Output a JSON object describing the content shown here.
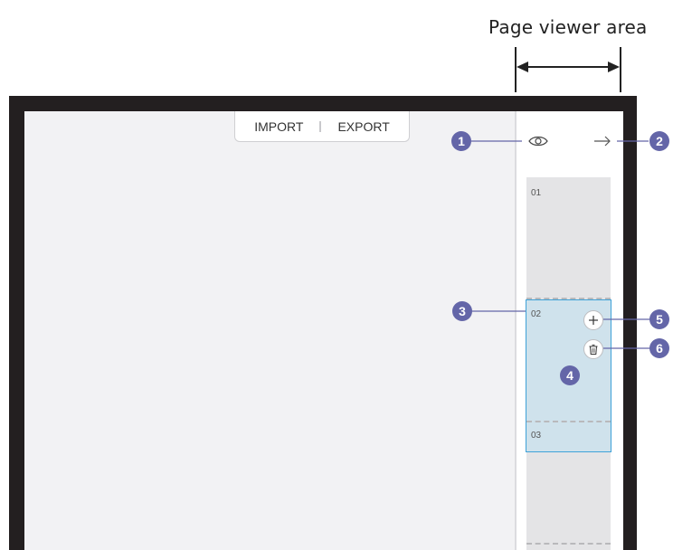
{
  "caption": "Page viewer area",
  "toolbar": {
    "import_label": "IMPORT",
    "export_label": "EXPORT"
  },
  "pages": [
    {
      "number": "01"
    },
    {
      "number": "02"
    },
    {
      "number": "03"
    }
  ],
  "callouts": [
    "1",
    "2",
    "3",
    "4",
    "5",
    "6"
  ],
  "icons": {
    "view": "eye-icon",
    "next": "arrow-right-icon",
    "add": "plus-icon",
    "delete": "trash-icon"
  },
  "colors": {
    "frame": "#231f20",
    "canvas": "#f2f2f4",
    "selected_page": "#cfe2ec",
    "selected_border": "#3fa2d8",
    "callout_badge": "#6466a8"
  }
}
